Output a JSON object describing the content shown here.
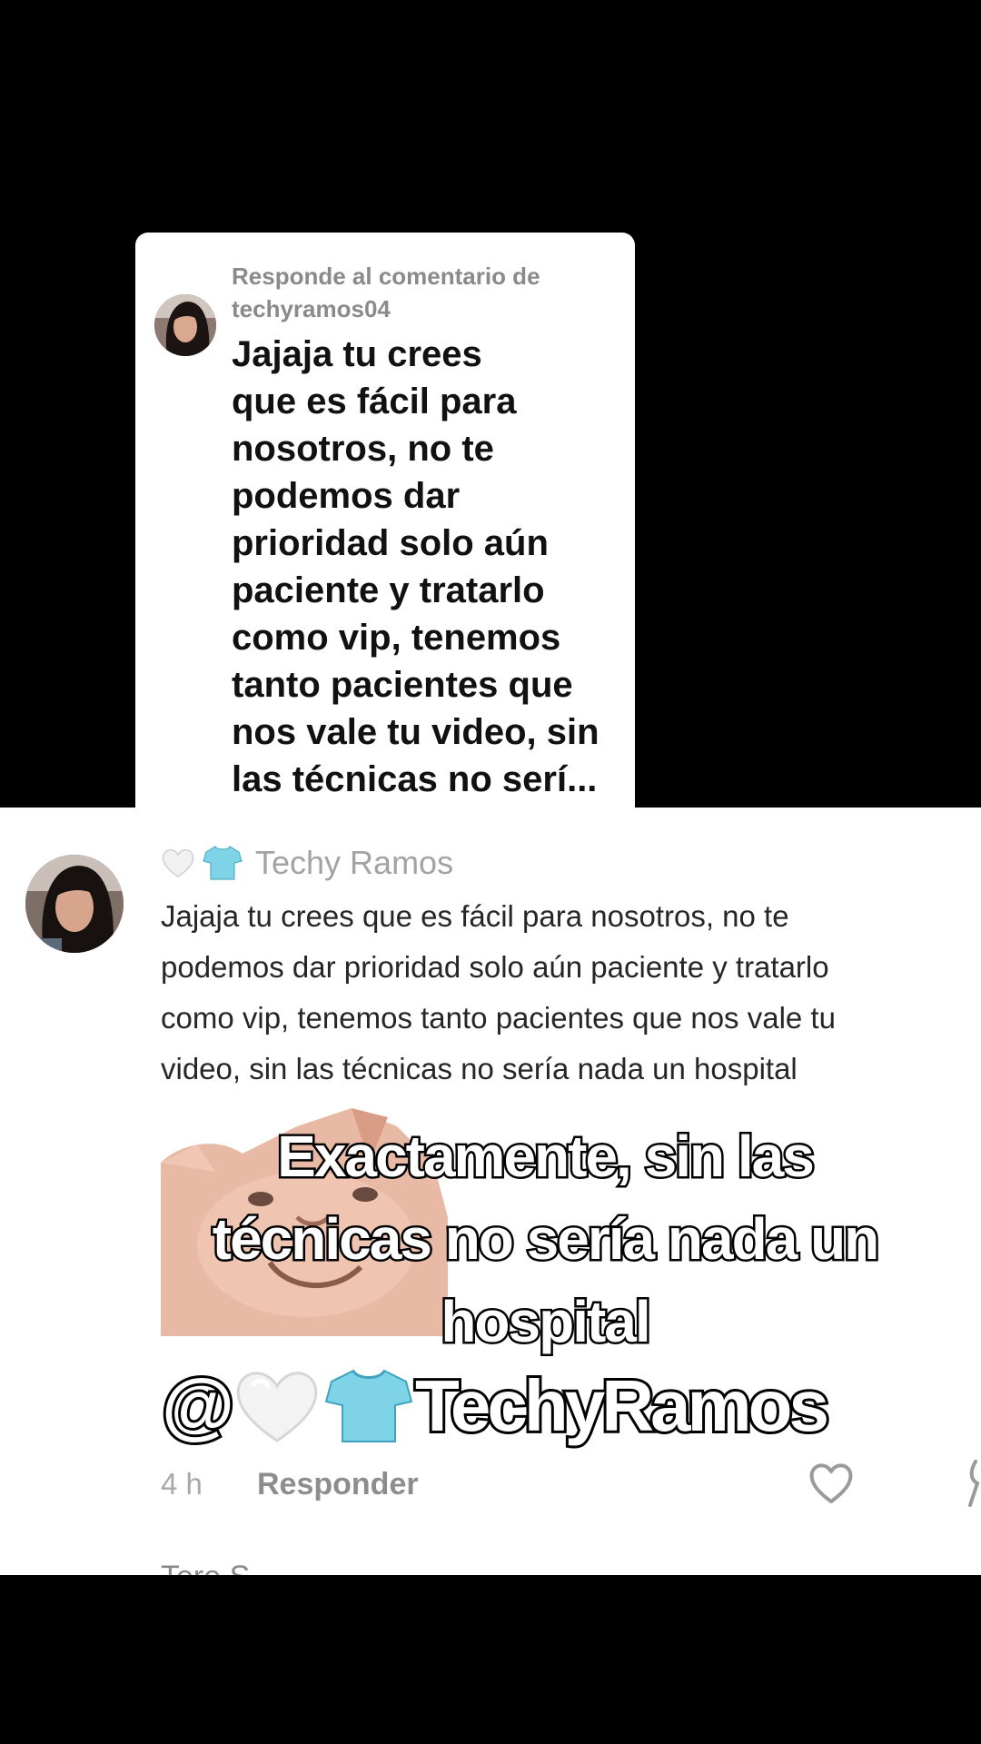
{
  "reply_card": {
    "header_line1": "Responde al comentario de",
    "header_line2": "techyramos04",
    "body_lines": [
      "Jajaja tu crees",
      "que es fácil para",
      "nosotros, no te",
      "podemos dar",
      "prioridad solo aún",
      "paciente y tratarlo",
      "como vip, tenemos",
      "tanto pacientes que",
      "nos vale tu video, sin",
      "las técnicas no serí..."
    ]
  },
  "comment": {
    "username": "Techy Ramos",
    "name_icons": [
      "white-heart-icon",
      "t-shirt-icon"
    ],
    "text_lines": [
      "Jajaja tu crees que es fácil para nosotros, no te",
      "podemos dar prioridad solo aún paciente y tratarlo",
      "como vip, tenemos tanto pacientes que nos vale tu",
      "video, sin las técnicas no sería nada un hospital"
    ],
    "time": "4 h",
    "reply_label": "Responder",
    "next_username_partial": "Tere S"
  },
  "caption": {
    "lines": [
      "Exactamente, sin las",
      "técnicas no sería nada un",
      "hospital"
    ],
    "mention_at": "@",
    "mention_name": "TechyRamos",
    "mention_icons": [
      "white-heart-icon",
      "t-shirt-icon"
    ]
  },
  "colors": {
    "background": "#000000",
    "card": "#ffffff",
    "muted_text": "#8a8a8a",
    "shirt": "#7fd3e6"
  }
}
